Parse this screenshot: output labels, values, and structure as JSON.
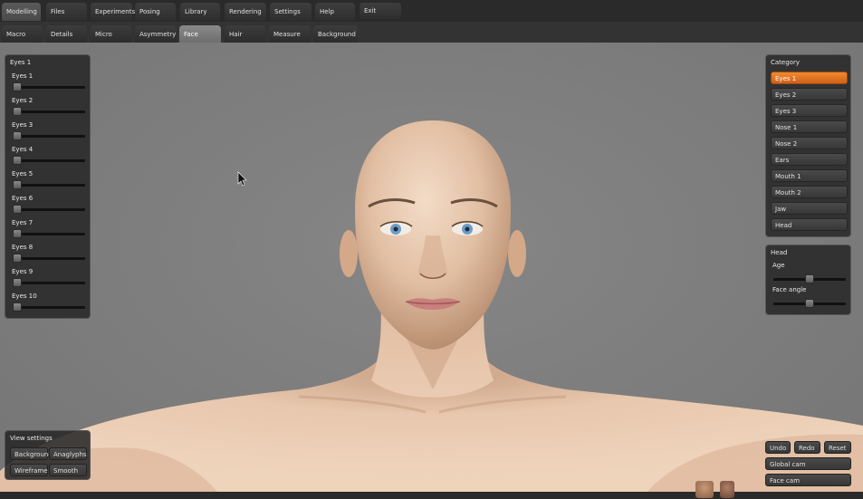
{
  "menu": {
    "tabs": [
      {
        "label": "Modelling",
        "active": true
      },
      {
        "label": "Files"
      },
      {
        "label": "Experiments"
      },
      {
        "label": "Posing"
      },
      {
        "label": "Library"
      },
      {
        "label": "Rendering"
      },
      {
        "label": "Settings"
      },
      {
        "label": "Help"
      }
    ],
    "exit_label": "Exit"
  },
  "subtabs": [
    {
      "label": "Macro"
    },
    {
      "label": "Details"
    },
    {
      "label": "Micro"
    },
    {
      "label": "Asymmetry"
    },
    {
      "label": "Face",
      "active": true
    },
    {
      "label": "Hair"
    },
    {
      "label": "Measure"
    },
    {
      "label": "Background"
    }
  ],
  "eyes_panel": {
    "title": "Eyes 1",
    "sliders": [
      {
        "label": "Eyes 1",
        "value": 0
      },
      {
        "label": "Eyes 2",
        "value": 0
      },
      {
        "label": "Eyes 3",
        "value": 0
      },
      {
        "label": "Eyes 4",
        "value": 0
      },
      {
        "label": "Eyes 5",
        "value": 0
      },
      {
        "label": "Eyes 6",
        "value": 0
      },
      {
        "label": "Eyes 7",
        "value": 0
      },
      {
        "label": "Eyes 8",
        "value": 0
      },
      {
        "label": "Eyes 9",
        "value": 0
      },
      {
        "label": "Eyes 10",
        "value": 0
      }
    ]
  },
  "category_panel": {
    "title": "Category",
    "items": [
      {
        "label": "Eyes 1",
        "selected": true
      },
      {
        "label": "Eyes 2"
      },
      {
        "label": "Eyes 3"
      },
      {
        "label": "Nose 1"
      },
      {
        "label": "Nose 2"
      },
      {
        "label": "Ears"
      },
      {
        "label": "Mouth 1"
      },
      {
        "label": "Mouth 2"
      },
      {
        "label": "Jaw"
      },
      {
        "label": "Head"
      }
    ]
  },
  "head_panel": {
    "title": "Head",
    "sliders": [
      {
        "label": "Age",
        "value": 0.5
      },
      {
        "label": "Face angle",
        "value": 0.5
      }
    ]
  },
  "view_settings": {
    "title": "View settings",
    "buttons": [
      "Background",
      "Anaglyphs",
      "Wireframe",
      "Smooth"
    ]
  },
  "history": {
    "undo": "Undo",
    "redo": "Redo",
    "reset": "Reset"
  },
  "cameras": {
    "global": "Global cam",
    "face": "Face cam"
  },
  "colors": {
    "accent": "#e8782a",
    "skin": "#e8c4a8",
    "background": "#7f7f7f"
  }
}
